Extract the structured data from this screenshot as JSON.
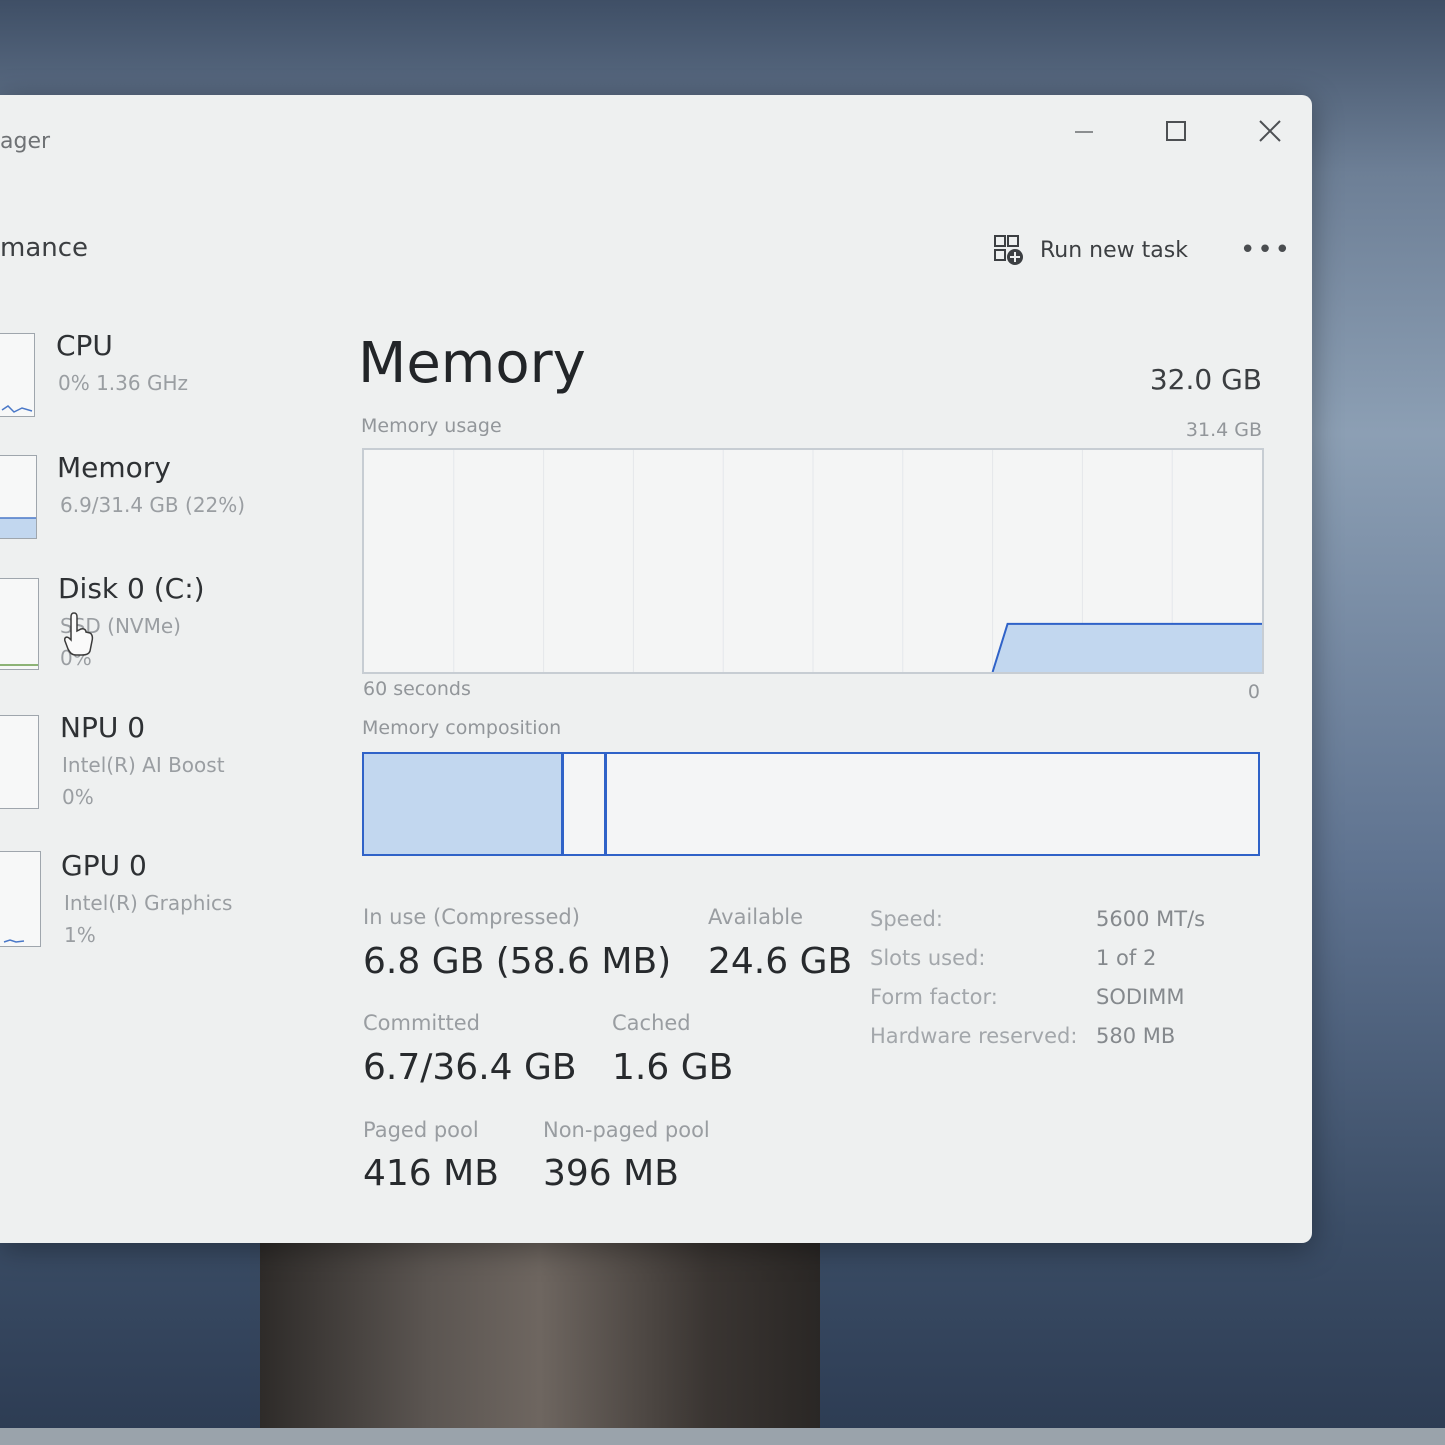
{
  "window": {
    "title": "ager",
    "section": "mance",
    "run_new_task": "Run new task",
    "more": "•••"
  },
  "sidebar": {
    "items": [
      {
        "name": "CPU",
        "line1": "0%  1.36 GHz",
        "line2": ""
      },
      {
        "name": "Memory",
        "line1": "6.9/31.4 GB (22%)",
        "line2": ""
      },
      {
        "name": "Disk 0 (C:)",
        "line1": "SSD (NVMe)",
        "line2": "0%"
      },
      {
        "name": "NPU 0",
        "line1": "Intel(R) AI Boost",
        "line2": "0%"
      },
      {
        "name": "GPU 0",
        "line1": "Intel(R) Graphics",
        "line2": "1%"
      }
    ]
  },
  "main": {
    "title": "Memory",
    "total": "32.0 GB",
    "usage_label": "Memory usage",
    "usage_max": "31.4 GB",
    "time_left": "60 seconds",
    "time_right": "0",
    "composition_label": "Memory composition"
  },
  "chart_data": {
    "type": "area",
    "x_range_seconds": [
      60,
      0
    ],
    "ylim": [
      0,
      31.4
    ],
    "ylabel": "",
    "series": [
      {
        "values": [
          0,
          0,
          0,
          0,
          0,
          0,
          0,
          0,
          0,
          0,
          0,
          0,
          0,
          0,
          0,
          0,
          0,
          0,
          0,
          0,
          0,
          0,
          0,
          0,
          0,
          0,
          0,
          0,
          0,
          0,
          0,
          0,
          0,
          0,
          0,
          0,
          0,
          0,
          0,
          0,
          0,
          0,
          0,
          6.8,
          6.8,
          6.8,
          6.8,
          6.8,
          6.8,
          6.8,
          6.8,
          6.8,
          6.8,
          6.8,
          6.8,
          6.8,
          6.8,
          6.8,
          6.8,
          6.8,
          6.8
        ]
      }
    ],
    "composition": {
      "in_use_fraction": 0.22,
      "modified_fraction": 0.045
    }
  },
  "stats": {
    "in_use_label": "In use (Compressed)",
    "in_use_value": "6.8 GB (58.6 MB)",
    "available_label": "Available",
    "available_value": "24.6 GB",
    "committed_label": "Committed",
    "committed_value": "6.7/36.4 GB",
    "cached_label": "Cached",
    "cached_value": "1.6 GB",
    "paged_label": "Paged pool",
    "paged_value": "416 MB",
    "nonpaged_label": "Non-paged pool",
    "nonpaged_value": "396 MB"
  },
  "specs": [
    {
      "label": "Speed:",
      "value": "5600 MT/s"
    },
    {
      "label": "Slots used:",
      "value": "1 of 2"
    },
    {
      "label": "Form factor:",
      "value": "SODIMM"
    },
    {
      "label": "Hardware reserved:",
      "value": "580 MB"
    }
  ],
  "colors": {
    "accent": "#2f62c8",
    "fill": "#c2d7ef",
    "window": "#eef0f0"
  }
}
